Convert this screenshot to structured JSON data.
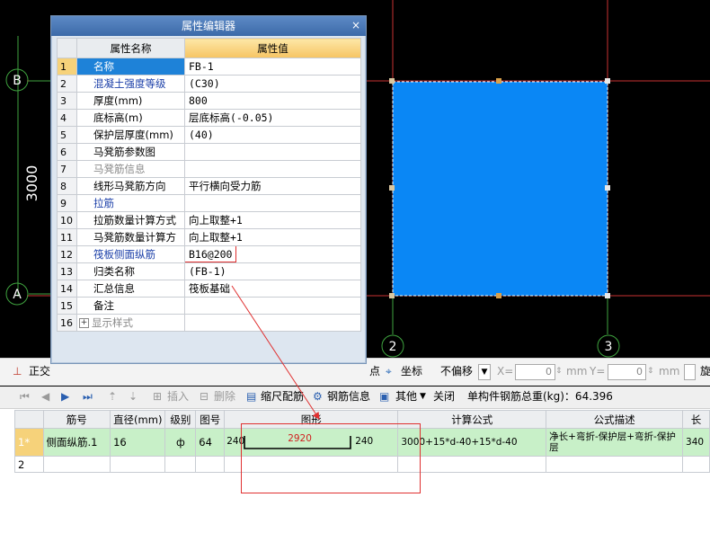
{
  "canvas": {
    "axis_labels": {
      "b": "B",
      "a": "A",
      "two": "2",
      "three": "3"
    },
    "dimension": "3000",
    "colors": {
      "slab": "#0a87f5",
      "grid_line": "#c83232",
      "axis_line": "#3fa33f"
    }
  },
  "dialog": {
    "title": "属性编辑器",
    "close_glyph": "×",
    "col_name": "属性名称",
    "col_value": "属性值",
    "rows": [
      {
        "idx": "1",
        "name": "名称",
        "value": "FB-1"
      },
      {
        "idx": "2",
        "name": "混凝土强度等级",
        "value": "(C30)"
      },
      {
        "idx": "3",
        "name": "厚度(mm)",
        "value": "800"
      },
      {
        "idx": "4",
        "name": "底标高(m)",
        "value": "层底标高(-0.05)"
      },
      {
        "idx": "5",
        "name": "保护层厚度(mm)",
        "value": "(40)"
      },
      {
        "idx": "6",
        "name": "马凳筋参数图",
        "value": ""
      },
      {
        "idx": "7",
        "name": "马凳筋信息",
        "value": ""
      },
      {
        "idx": "8",
        "name": "线形马凳筋方向",
        "value": "平行横向受力筋"
      },
      {
        "idx": "9",
        "name": "拉筋",
        "value": ""
      },
      {
        "idx": "10",
        "name": "拉筋数量计算方式",
        "value": "向上取整+1"
      },
      {
        "idx": "11",
        "name": "马凳筋数量计算方",
        "value": "向上取整+1"
      },
      {
        "idx": "12",
        "name": "筏板侧面纵筋",
        "value": "B16@200"
      },
      {
        "idx": "13",
        "name": "归类名称",
        "value": "(FB-1)"
      },
      {
        "idx": "14",
        "name": "汇总信息",
        "value": "筏板基础"
      },
      {
        "idx": "15",
        "name": "备注",
        "value": ""
      },
      {
        "idx": "16",
        "name": "显示样式",
        "value": "",
        "expander": "+"
      }
    ]
  },
  "toolbar1": {
    "ortho": "正交",
    "point": "点",
    "coord": "坐标",
    "offset_select": "不偏移",
    "x_label": "X=",
    "x_value": "0",
    "y_label": "Y=",
    "y_value": "0",
    "unit_x": "mm",
    "unit_y": "mm",
    "rotate": "旋"
  },
  "toolbar2": {
    "insert": "插入",
    "delete": "删除",
    "scale_rebar": "缩尺配筋",
    "rebar_info": "钢筋信息",
    "other": "其他",
    "close": "关闭",
    "total_weight": "单构件钢筋总重(kg)：64.396"
  },
  "rebar_table": {
    "headers": [
      "筋号",
      "直径(mm)",
      "级别",
      "图号",
      "图形",
      "计算公式",
      "公式描述",
      "长"
    ],
    "rows": [
      {
        "idx": "1*",
        "name": "侧面纵筋.1",
        "diameter": "16",
        "grade": "ф",
        "fig_no": "64",
        "shape_left": "240",
        "shape_mid": "2920",
        "shape_right": "240",
        "formula": "3000+15*d-40+15*d-40",
        "desc": "净长+弯折-保护层+弯折-保护层",
        "length": "340"
      },
      {
        "idx": "2",
        "name": "",
        "diameter": "",
        "grade": "",
        "fig_no": "",
        "formula": "",
        "desc": "",
        "length": ""
      }
    ]
  }
}
